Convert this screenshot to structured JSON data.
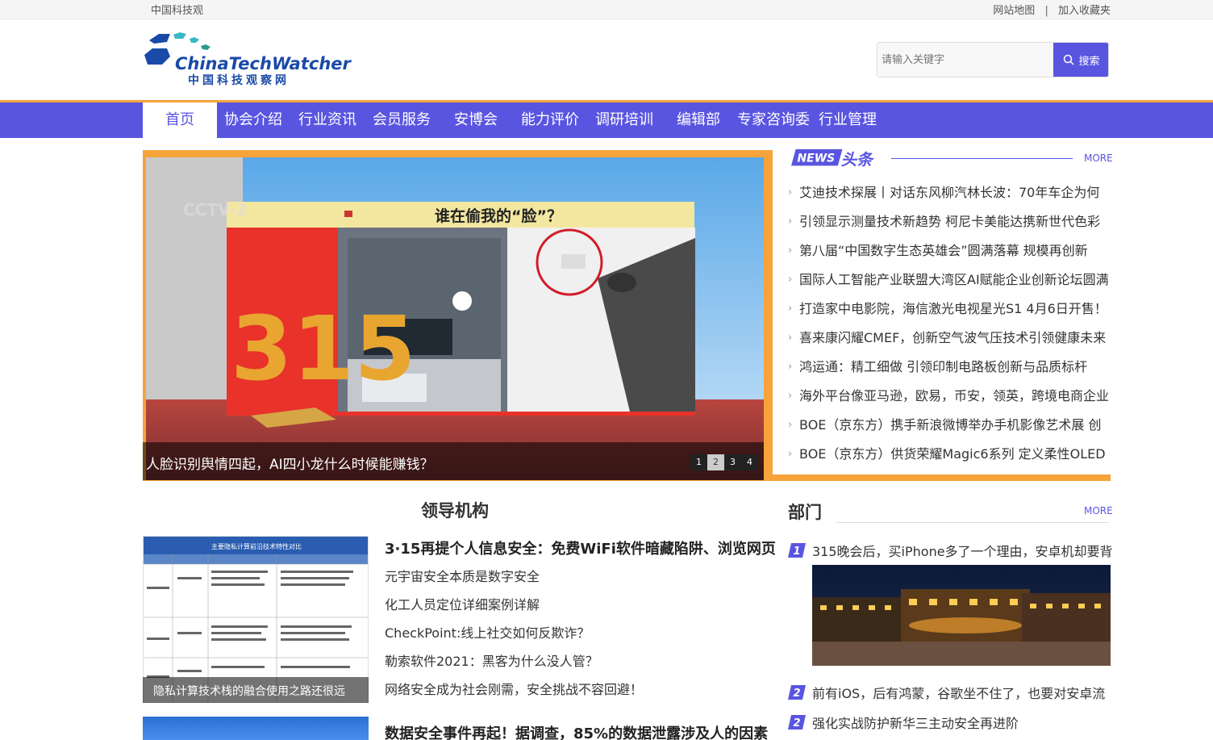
{
  "topbar": {
    "site_name": "中国科技观",
    "sitemap_label": "网站地图",
    "separator": "|",
    "favorite_label": "加入收藏夹"
  },
  "logo": {
    "text_en": "ChinaTechWatcher",
    "text_cn": "中国科技观察网"
  },
  "search": {
    "placeholder": "请输入关键字",
    "button_label": "搜索"
  },
  "nav": {
    "items": [
      "首页",
      "协会介绍",
      "行业资讯",
      "会员服务",
      "安博会",
      "能力评价",
      "调研培训",
      "编辑部",
      "专家咨询委",
      "行业管理"
    ],
    "active_index": 0
  },
  "slider": {
    "caption": "人脸识别舆情四起，AI四小龙什么时候能赚钱？",
    "image_text": {
      "channel": "CCTV-2",
      "banner": "谁在偷我的“脸”？",
      "number": "315"
    },
    "pages": [
      "1",
      "2",
      "3",
      "4"
    ],
    "active_page": 1
  },
  "news": {
    "logo_en": "NEWS",
    "logo_cn": "头条",
    "more_label": "MORE",
    "items": [
      "艾迪技术探展丨对话东风柳汽林长波：70年车企为何",
      "引领显示测量技术新趋势 柯尼卡美能达携新世代色彩",
      "第八届“中国数字生态英雄会”圆满落幕 规模再创新",
      "国际人工智能产业联盟大湾区AI赋能企业创新论坛圆满",
      "打造家中电影院，海信激光电视星光S1 4月6日开售！",
      "喜来康闪耀CMEF，创新空气波气压技术引领健康未来",
      "鸿运通：精工细做 引领印制电路板创新与品质标杆",
      "海外平台像亚马逊，欧易，币安，领英，跨境电商企业",
      "BOE（京东方）携手新浪微博举办手机影像艺术展 创",
      "BOE（京东方）供货荣耀Magic6系列 定义柔性OLED"
    ]
  },
  "leadership": {
    "title": "领导机构",
    "thumb_caption": "隐私计算技术栈的融合使用之路还很远",
    "thumb_table_title": "主要隐私计算前沿技术特性对比",
    "headline": "3·15再提个人信息安全：免费WiFi软件暗藏陷阱、浏览网页",
    "items": [
      "元宇宙安全本质是数字安全",
      "化工人员定位详细案例详解",
      "CheckPoint:线上社交如何反欺诈？",
      "勒索软件2021：黑客为什么没人管？",
      "网络安全成为社会刚需，安全挑战不容回避！"
    ],
    "headline2": "数据安全事件再起！据调查，85%的数据泄露涉及人的因素"
  },
  "dept": {
    "title": "部门",
    "more_label": "MORE",
    "items": [
      {
        "badge": "1",
        "text": "315晚会后，买iPhone多了一个理由，安卓机却要背"
      },
      {
        "badge": "2",
        "text": "前有iOS，后有鸿蒙，谷歌坐不住了，也要对安卓流"
      },
      {
        "badge": "2",
        "text": "强化实战防护新华三主动安全再进阶"
      }
    ]
  },
  "colors": {
    "primary": "#5a55e0",
    "accent": "#f6a33a"
  }
}
